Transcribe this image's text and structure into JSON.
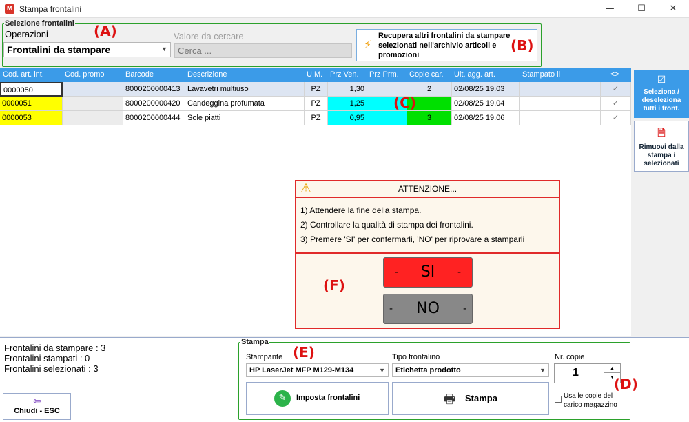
{
  "window": {
    "title": "Stampa frontalini",
    "app_icon": "M",
    "minimize": "—",
    "maximize": "☐",
    "close": "✕"
  },
  "selezione": {
    "legend": "Selezione frontalini",
    "operazioni_label": "Operazioni",
    "operazioni_value": "Frontalini da stampare",
    "valore_label": "Valore da cercare",
    "search_placeholder": "Cerca ...",
    "recupera_button": "Recupera altri frontalini da stampare selezionati nell'archivio articoli e promozioni"
  },
  "markers": {
    "a": "(A)",
    "b": "(B)",
    "c": "(C)",
    "d": "(D)",
    "e": "(E)",
    "f": "(F)"
  },
  "grid": {
    "headers": [
      "Cod. art. int.",
      "Cod. promo",
      "Barcode",
      "Descrizione",
      "U.M.",
      "Prz Ven.",
      "Prz Prm.",
      "Copie car.",
      "Ult. agg. art.",
      "Stampato il",
      "<>"
    ],
    "rows": [
      {
        "cod": "0000050",
        "promo": "",
        "barcode": "8000200000413",
        "desc": "Lavavetri multiuso",
        "um": "PZ",
        "prz_ven": "1,30",
        "prz_prm": "",
        "copie": "2",
        "ult_agg": "02/08/25 19.03",
        "stampato": "",
        "check": "✓"
      },
      {
        "cod": "0000051",
        "promo": "",
        "barcode": "8000200000420",
        "desc": "Candeggina profumata",
        "um": "PZ",
        "prz_ven": "1,25",
        "prz_prm": "",
        "copie": "",
        "ult_agg": "02/08/25 19.04",
        "stampato": "",
        "check": "✓"
      },
      {
        "cod": "0000053",
        "promo": "",
        "barcode": "8000200000444",
        "desc": "Sole piatti",
        "um": "PZ",
        "prz_ven": "0,95",
        "prz_prm": "",
        "copie": "3",
        "ult_agg": "02/08/25 19.06",
        "stampato": "",
        "check": "✓"
      }
    ]
  },
  "side": {
    "select_all": "Seleziona / deseleziona tutti i front.",
    "remove": "Rimuovi dalla stampa i selezionati"
  },
  "dialog": {
    "title": "ATTENZIONE...",
    "line1": "1) Attendere  la fine della stampa.",
    "line2": "2) Controllare  la qualità  di stampa  dei frontalini.",
    "line3": "3) Premere 'SI' per confermarli, 'NO' per riprovare a stamparli",
    "si": "SI",
    "no": "NO",
    "dash": "-"
  },
  "status": {
    "da_stampare": "Frontalini da stampare : 3",
    "stampati": "Frontalini stampati : 0",
    "selezionati": "Frontalini selezionati : 3"
  },
  "chiudi": "Chiudi - ESC",
  "stampa": {
    "legend": "Stampa",
    "stampante_label": "Stampante",
    "stampante_value": "HP LaserJet MFP M129-M134",
    "tipo_label": "Tipo frontalino",
    "tipo_value": "Etichetta prodotto",
    "copie_label": "Nr. copie",
    "copie_value": "1",
    "imposta_button": "Imposta frontalini",
    "stampa_button": "Stampa",
    "usa_copie_label": "Usa le copie del carico magazzino"
  },
  "colors": {
    "accent": "#3b9be8",
    "yellow": "#ffff00",
    "cyan": "#00ffff",
    "green": "#00e000",
    "red": "#e02a2a",
    "group": "#2ba12b"
  }
}
